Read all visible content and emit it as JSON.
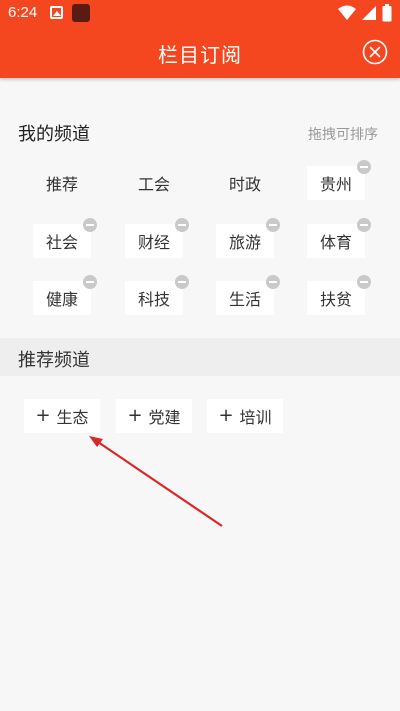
{
  "status": {
    "time": "6:24"
  },
  "header": {
    "title": "栏目订阅"
  },
  "my_channels": {
    "title": "我的频道",
    "hint": "拖拽可排序",
    "items": [
      {
        "label": "推荐"
      },
      {
        "label": "工会"
      },
      {
        "label": "时政"
      },
      {
        "label": "贵州"
      },
      {
        "label": "社会"
      },
      {
        "label": "财经"
      },
      {
        "label": "旅游"
      },
      {
        "label": "体育"
      },
      {
        "label": "健康"
      },
      {
        "label": "科技"
      },
      {
        "label": "生活"
      },
      {
        "label": "扶贫"
      }
    ]
  },
  "recommended": {
    "title": "推荐频道",
    "items": [
      {
        "label": "生态"
      },
      {
        "label": "党建"
      },
      {
        "label": "培训"
      }
    ]
  },
  "colors": {
    "brand": "#f5471f",
    "annotation_arrow": "#d8282a"
  }
}
